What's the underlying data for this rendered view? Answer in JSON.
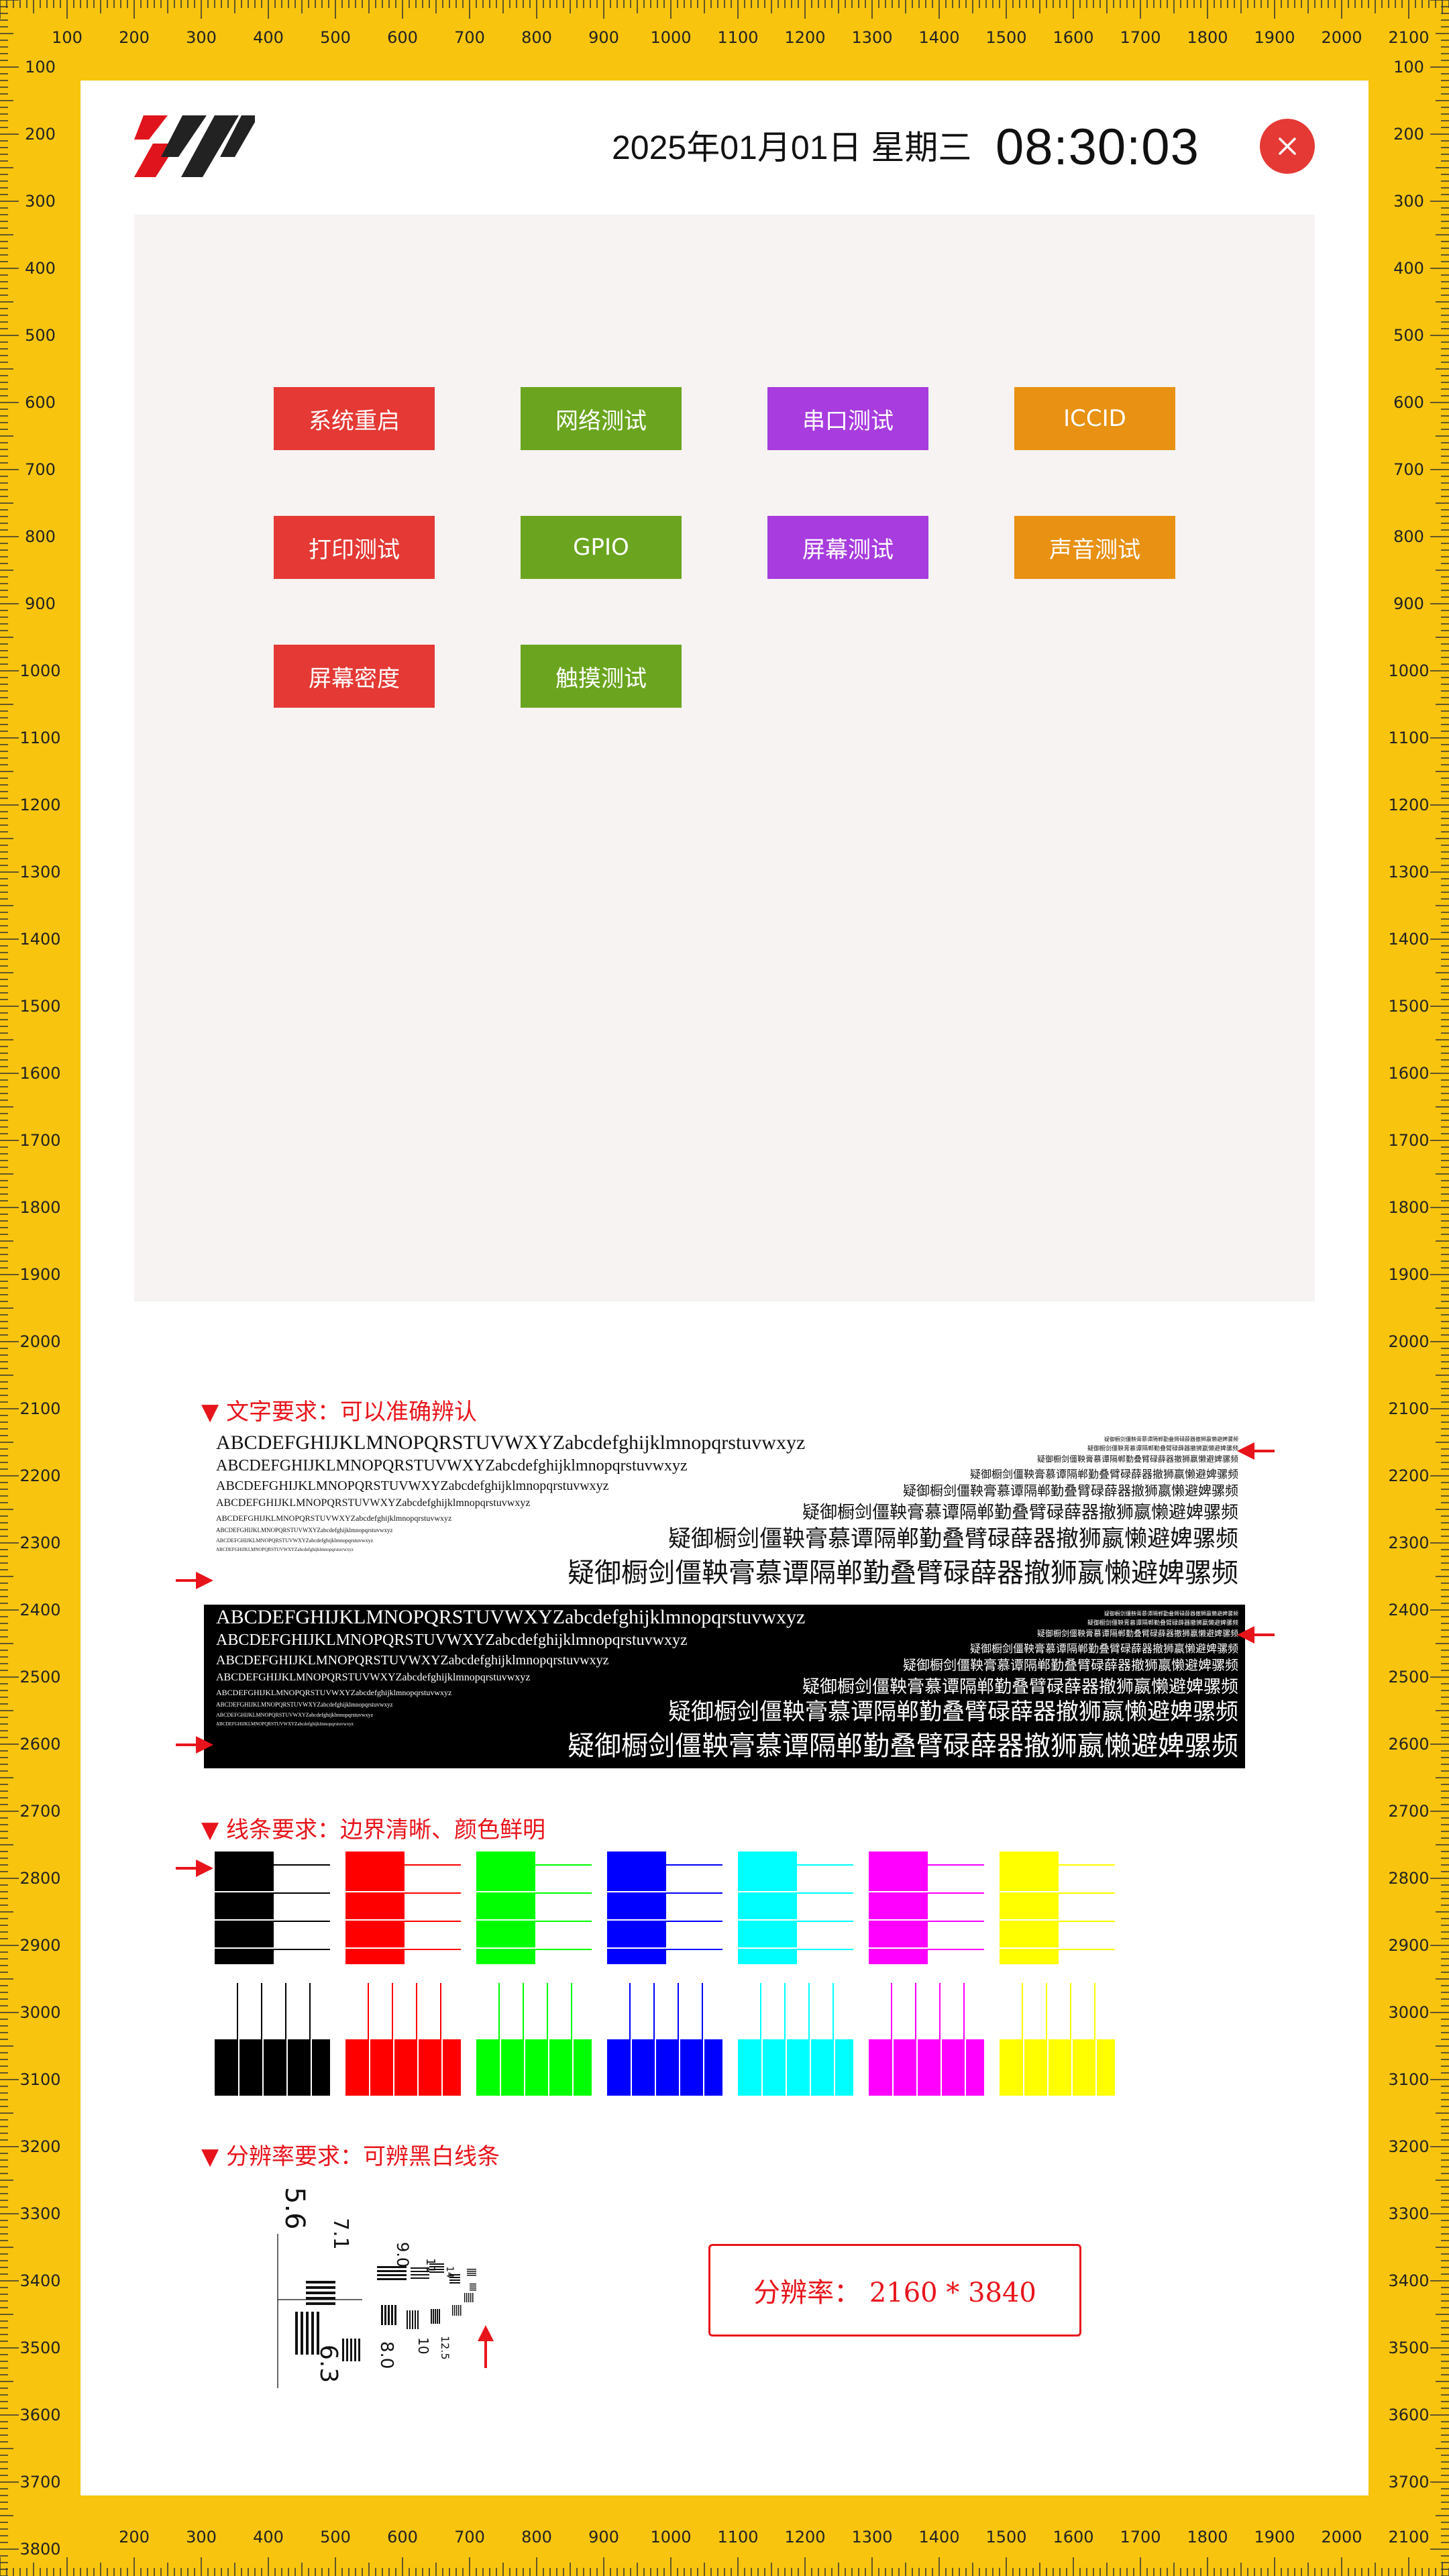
{
  "header": {
    "date_text": "2025年01月01日 星期三",
    "time_text": "08:30:03"
  },
  "ruler": {
    "top_labels": [
      "100",
      "200",
      "300",
      "400",
      "500",
      "600",
      "700",
      "800",
      "900",
      "1000",
      "1100",
      "1200",
      "1300",
      "1400",
      "1500",
      "1600",
      "1700",
      "1800",
      "1900",
      "2000",
      "2100"
    ],
    "bottom_labels": [
      "200",
      "300",
      "400",
      "500",
      "600",
      "700",
      "800",
      "900",
      "1000",
      "1100",
      "1200",
      "1300",
      "1400",
      "1500",
      "1600",
      "1700",
      "1800",
      "1900",
      "2000",
      "2100"
    ],
    "left_labels": [
      "100",
      "200",
      "300",
      "400",
      "500",
      "600",
      "700",
      "800",
      "900",
      "1000",
      "1100",
      "1200",
      "1300",
      "1400",
      "1500",
      "1600",
      "1700",
      "1800",
      "1900",
      "2000",
      "2100",
      "2200",
      "2300",
      "2400",
      "2500",
      "2600",
      "2700",
      "2800",
      "2900",
      "3000",
      "3100",
      "3200",
      "3300",
      "3400",
      "3500",
      "3600",
      "3700",
      "3800"
    ],
    "right_labels": [
      "100",
      "200",
      "300",
      "400",
      "500",
      "600",
      "700",
      "800",
      "900",
      "1000",
      "1100",
      "1200",
      "1300",
      "1400",
      "1500",
      "1600",
      "1700",
      "1800",
      "1900",
      "2000",
      "2100",
      "2200",
      "2300",
      "2400",
      "2500",
      "2600",
      "2700",
      "2800",
      "2900",
      "3000",
      "3100",
      "3200",
      "3300",
      "3400",
      "3500",
      "3600",
      "3700"
    ]
  },
  "buttons": [
    {
      "label": "系统重启",
      "color": "#E53935"
    },
    {
      "label": "网络测试",
      "color": "#6BA51F"
    },
    {
      "label": "串口测试",
      "color": "#A83CDF"
    },
    {
      "label": "ICCID",
      "color": "#E89112"
    },
    {
      "label": "打印测试",
      "color": "#E53935"
    },
    {
      "label": "GPIO",
      "color": "#6BA51F"
    },
    {
      "label": "屏幕测试",
      "color": "#A83CDF"
    },
    {
      "label": "声音测试",
      "color": "#E89112"
    },
    {
      "label": "屏幕密度",
      "color": "#E53935"
    },
    {
      "label": "触摸测试",
      "color": "#6BA51F"
    }
  ],
  "sections": {
    "text_title": "▼ 文字要求：可以准确辨认",
    "line_title": "▼ 线条要求：边界清晰、颜色鲜明",
    "res_title": "▼ 分辨率要求：可辨黑白线条"
  },
  "samples": {
    "latin": "ABCDEFGHIJKLMNOPQRSTUVWXYZabcdefghijklmnopqrstuvwxyz",
    "cjk": "疑御橱剑僵鞅膏慕谭隔郸勤叠臂碌薛器撤狮嬴懒避婢骡频"
  },
  "chart_ticks": {
    "n56": "5.6",
    "n63": "6.3",
    "n71": "7.1",
    "n80": "8.0",
    "n90": "9.0",
    "n10": "10",
    "n11": "11",
    "n12": "12.5",
    "n14": "14"
  },
  "resolution": {
    "label": "分辨率： 2160 * 3840"
  },
  "colors": {
    "accent_red": "#E8141B",
    "ruler_yellow": "#F8C40E",
    "line_colors": [
      "#000000",
      "#FF0000",
      "#00FF00",
      "#0000FF",
      "#00FFFF",
      "#FF00FF",
      "#FFFF00"
    ]
  }
}
